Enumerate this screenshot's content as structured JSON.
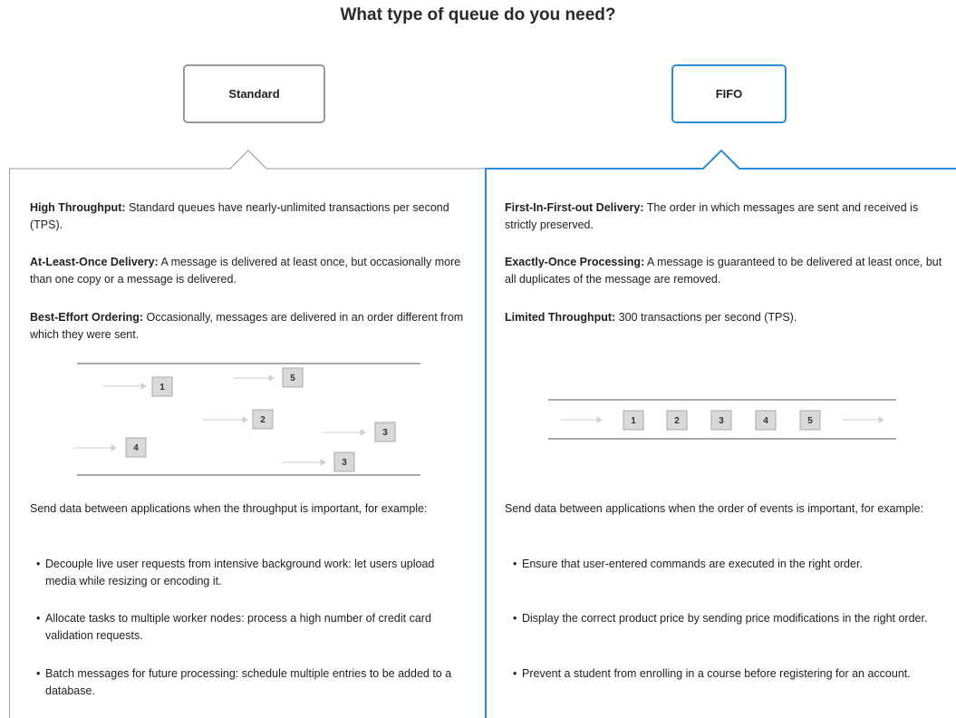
{
  "title": "What type of queue do you need?",
  "options": {
    "standard": "Standard",
    "fifo": "FIFO"
  },
  "standard": {
    "features": [
      {
        "label": "High Throughput:",
        "text": " Standard queues have nearly-unlimited transactions per second (TPS)."
      },
      {
        "label": "At-Least-Once Delivery:",
        "text": " A message is delivered at least once, but occasionally more than one copy or a message is delivered."
      },
      {
        "label": "Best-Effort Ordering:",
        "text": " Occasionally, messages are delivered in an order different from which they were sent."
      }
    ],
    "diagram_boxes": [
      "1",
      "5",
      "2",
      "3",
      "4",
      "3"
    ],
    "intro": "Send data between applications when the throughput is important, for example:",
    "examples": [
      "Decouple live user requests from intensive background work: let users upload media while resizing or encoding it.",
      "Allocate tasks to multiple worker nodes: process a high number of credit card validation requests.",
      "Batch messages for future processing: schedule multiple entries to be added to a database."
    ]
  },
  "fifo": {
    "features": [
      {
        "label": "First-In-First-out Delivery:",
        "text": " The order in which messages are sent and received is strictly preserved."
      },
      {
        "label": "Exactly-Once Processing:",
        "text": " A message is guaranteed to be delivered at least once, but all duplicates of the message are removed."
      },
      {
        "label": "Limited Throughput:",
        "text": " 300 transactions per second (TPS)."
      }
    ],
    "diagram_boxes": [
      "1",
      "2",
      "3",
      "4",
      "5"
    ],
    "intro": "Send data between applications when the order of events is important, for example:",
    "examples": [
      "Ensure that user-entered commands are executed in the right order.",
      "Display the correct product price by sending price modifications in the right order.",
      "Prevent a student from enrolling in a course before registering for an account."
    ]
  },
  "colors": {
    "standard_border": "#9a9a9a",
    "fifo_border": "#2a8fd8",
    "box_fill": "#d9d9d9",
    "arrow": "#c8c8c8"
  }
}
